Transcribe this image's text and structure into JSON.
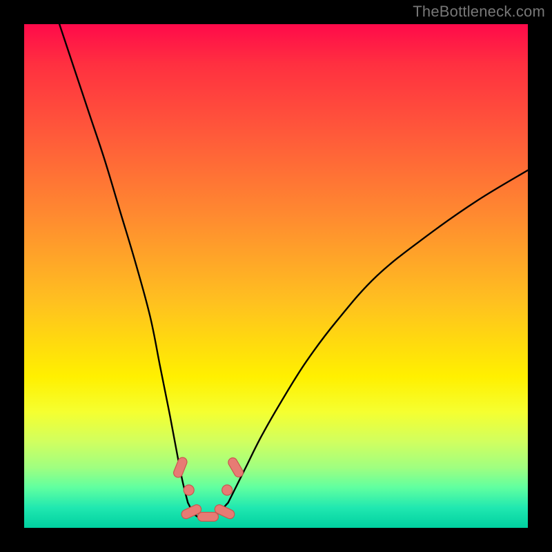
{
  "watermark": "TheBottleneck.com",
  "chart_data": {
    "type": "line",
    "title": "",
    "xlabel": "",
    "ylabel": "",
    "xlim": [
      0,
      100
    ],
    "ylim": [
      0,
      100
    ],
    "series": [
      {
        "name": "left-curve",
        "x": [
          7,
          10,
          13,
          16,
          19,
          22,
          25,
          27,
          29,
          30.5,
          31.5,
          32.5
        ],
        "y": [
          100,
          91,
          82,
          73,
          63,
          53,
          42,
          32,
          22,
          14,
          9,
          5
        ]
      },
      {
        "name": "right-curve",
        "x": [
          40.5,
          42,
          44,
          47,
          51,
          56,
          62,
          70,
          80,
          90,
          100
        ],
        "y": [
          5,
          8,
          12,
          18,
          25,
          33,
          41,
          50,
          58,
          65,
          71
        ]
      },
      {
        "name": "bottom-flat",
        "x": [
          32.5,
          34,
          36,
          38,
          40.5
        ],
        "y": [
          5,
          2.5,
          2,
          2.5,
          5
        ]
      }
    ],
    "markers": [
      {
        "name": "dot",
        "x": 32.7,
        "y": 7.5
      },
      {
        "name": "dot",
        "x": 40.3,
        "y": 7.5
      },
      {
        "name": "pill-l",
        "x": 31.0,
        "y": 12,
        "angle": -68
      },
      {
        "name": "pill-r",
        "x": 42.0,
        "y": 12,
        "angle": 60
      },
      {
        "name": "pill-bl",
        "x": 33.2,
        "y": 3.2,
        "angle": -25
      },
      {
        "name": "pill-bc",
        "x": 36.5,
        "y": 2.2,
        "angle": 0
      },
      {
        "name": "pill-br",
        "x": 39.8,
        "y": 3.2,
        "angle": 25
      }
    ],
    "colors": {
      "curve": "#000000",
      "marker_fill": "#e77b74",
      "marker_stroke": "#c9564e"
    }
  }
}
